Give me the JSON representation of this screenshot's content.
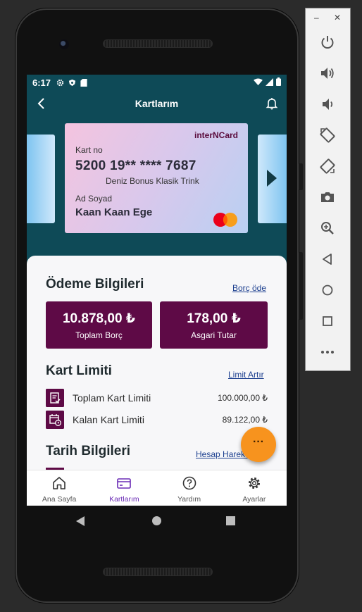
{
  "status_bar": {
    "time": "6:17"
  },
  "app_bar": {
    "title": "Kartlarım"
  },
  "card": {
    "brand": "interNCard",
    "number_label": "Kart no",
    "number": "5200 19** **** 7687",
    "product_name": "Deniz Bonus Klasik Trink",
    "holder_label": "Ad Soyad",
    "holder_name": "Kaan Kaan Ege"
  },
  "payment_info": {
    "title": "Ödeme Bilgileri",
    "action_link": "Borç öde",
    "total_debt": {
      "amount": "10.878,00 ₺",
      "label": "Toplam Borç"
    },
    "minimum_due": {
      "amount": "178,00 ₺",
      "label": "Asgari Tutar"
    }
  },
  "card_limit": {
    "title": "Kart Limiti",
    "action_link": "Limit Artır",
    "rows": [
      {
        "label": "Toplam Kart Limiti",
        "value": "100.000,00 ₺"
      },
      {
        "label": "Kalan Kart Limiti",
        "value": "89.122,00 ₺"
      }
    ]
  },
  "date_info": {
    "title": "Tarih Bilgileri",
    "action_link": "Hesap Hareket"
  },
  "fab": {
    "label": "···"
  },
  "bottom_nav": [
    {
      "label": "Ana Sayfa",
      "icon": "home-icon"
    },
    {
      "label": "Kartlarım",
      "icon": "card-icon",
      "active": true
    },
    {
      "label": "Yardım",
      "icon": "help-icon"
    },
    {
      "label": "Ayarlar",
      "icon": "settings-icon"
    }
  ],
  "emulator_panel": {
    "minimize": "–",
    "close": "✕",
    "buttons": [
      "power-icon",
      "volume-up-icon",
      "volume-down-icon",
      "rotate-left-icon",
      "rotate-right-icon",
      "camera-icon",
      "zoom-icon",
      "back-icon",
      "home-icon",
      "overview-icon",
      "more-icon"
    ]
  },
  "colors": {
    "header_bg": "#0e4a57",
    "accent": "#5e0a46",
    "fab": "#f7931e",
    "active_nav": "#6a2bb5",
    "link": "#1c3f8f"
  }
}
